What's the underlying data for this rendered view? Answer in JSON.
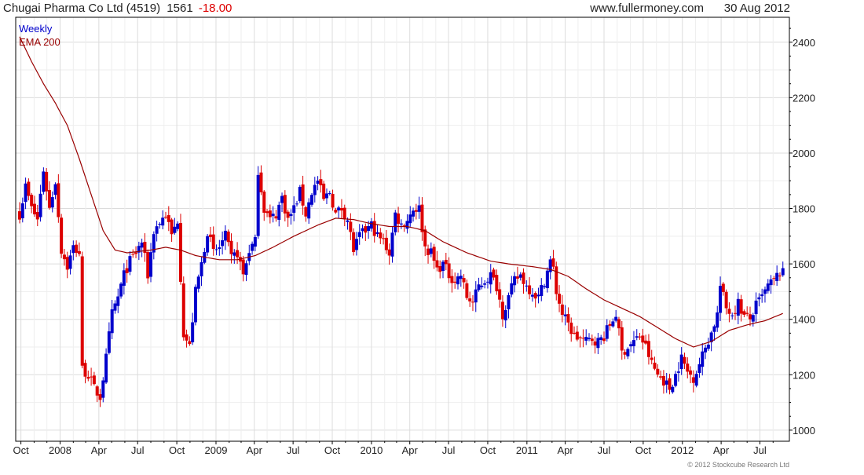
{
  "header": {
    "company": "Chugai Pharma Co Ltd (4519)",
    "price": "1561",
    "change": "-18.00",
    "website": "www.fullermoney.com",
    "date": "30 Aug 2012"
  },
  "legend": {
    "series_label": "Weekly",
    "ema_label": "EMA 200"
  },
  "copyright": "© 2012 Stockcube Research Ltd",
  "colors": {
    "up": "#0000cc",
    "down": "#dd0000",
    "ema": "#990000",
    "grid": "#dcdcdc",
    "frame": "#000000",
    "change_text": "#dd0000"
  },
  "chart_data": {
    "type": "candlestick",
    "period": "weekly",
    "ylim": [
      960,
      2490
    ],
    "yticks": [
      1000,
      1200,
      1400,
      1600,
      1800,
      2000,
      2200,
      2400
    ],
    "grid": true,
    "legend_placement": "top-left",
    "x_tick_labels": [
      "Oct",
      "2008",
      "Apr",
      "Jul",
      "Oct",
      "2009",
      "Apr",
      "Jul",
      "Oct",
      "2010",
      "Apr",
      "Jul",
      "Oct",
      "2011",
      "Apr",
      "Jul",
      "Oct",
      "2012",
      "Apr",
      "Jul"
    ],
    "start_date": "2007-09-28",
    "end_date": "2012-08-30",
    "close_anchors": [
      [
        "2007-09-28",
        1780
      ],
      [
        "2007-10-12",
        1880
      ],
      [
        "2007-10-26",
        1800
      ],
      [
        "2007-11-09",
        1760
      ],
      [
        "2007-11-23",
        1940
      ],
      [
        "2007-12-07",
        1800
      ],
      [
        "2007-12-21",
        1900
      ],
      [
        "2008-01-04",
        1650
      ],
      [
        "2008-01-18",
        1590
      ],
      [
        "2008-02-01",
        1660
      ],
      [
        "2008-02-15",
        1640
      ],
      [
        "2008-02-22",
        1220
      ],
      [
        "2008-03-07",
        1200
      ],
      [
        "2008-03-21",
        1150
      ],
      [
        "2008-04-04",
        1120
      ],
      [
        "2008-04-18",
        1260
      ],
      [
        "2008-05-02",
        1420
      ],
      [
        "2008-05-16",
        1480
      ],
      [
        "2008-05-30",
        1560
      ],
      [
        "2008-06-13",
        1610
      ],
      [
        "2008-06-27",
        1640
      ],
      [
        "2008-07-11",
        1680
      ],
      [
        "2008-07-25",
        1560
      ],
      [
        "2008-08-08",
        1720
      ],
      [
        "2008-08-22",
        1750
      ],
      [
        "2008-09-05",
        1780
      ],
      [
        "2008-09-19",
        1700
      ],
      [
        "2008-10-03",
        1760
      ],
      [
        "2008-10-17",
        1350
      ],
      [
        "2008-10-31",
        1300
      ],
      [
        "2008-11-14",
        1500
      ],
      [
        "2008-11-28",
        1600
      ],
      [
        "2008-12-12",
        1720
      ],
      [
        "2008-12-26",
        1640
      ],
      [
        "2009-01-09",
        1660
      ],
      [
        "2009-01-23",
        1700
      ],
      [
        "2009-02-06",
        1620
      ],
      [
        "2009-02-20",
        1640
      ],
      [
        "2009-03-06",
        1560
      ],
      [
        "2009-03-20",
        1650
      ],
      [
        "2009-04-03",
        1680
      ],
      [
        "2009-04-10",
        1940
      ],
      [
        "2009-04-24",
        1800
      ],
      [
        "2009-05-08",
        1760
      ],
      [
        "2009-05-22",
        1780
      ],
      [
        "2009-06-05",
        1840
      ],
      [
        "2009-06-19",
        1760
      ],
      [
        "2009-07-03",
        1800
      ],
      [
        "2009-07-17",
        1860
      ],
      [
        "2009-07-31",
        1780
      ],
      [
        "2009-08-14",
        1860
      ],
      [
        "2009-08-28",
        1900
      ],
      [
        "2009-09-11",
        1830
      ],
      [
        "2009-09-25",
        1860
      ],
      [
        "2009-10-09",
        1780
      ],
      [
        "2009-10-23",
        1800
      ],
      [
        "2009-11-06",
        1760
      ],
      [
        "2009-11-20",
        1650
      ],
      [
        "2009-12-04",
        1700
      ],
      [
        "2009-12-18",
        1720
      ],
      [
        "2010-01-01",
        1740
      ],
      [
        "2010-01-15",
        1700
      ],
      [
        "2010-01-29",
        1680
      ],
      [
        "2010-02-12",
        1640
      ],
      [
        "2010-02-26",
        1780
      ],
      [
        "2010-03-12",
        1740
      ],
      [
        "2010-03-26",
        1760
      ],
      [
        "2010-04-09",
        1800
      ],
      [
        "2010-04-23",
        1800
      ],
      [
        "2010-05-07",
        1660
      ],
      [
        "2010-05-21",
        1640
      ],
      [
        "2010-06-04",
        1580
      ],
      [
        "2010-06-18",
        1600
      ],
      [
        "2010-07-02",
        1560
      ],
      [
        "2010-07-16",
        1540
      ],
      [
        "2010-07-30",
        1560
      ],
      [
        "2010-08-13",
        1480
      ],
      [
        "2010-08-27",
        1460
      ],
      [
        "2010-09-10",
        1520
      ],
      [
        "2010-09-24",
        1540
      ],
      [
        "2010-10-08",
        1560
      ],
      [
        "2010-10-22",
        1520
      ],
      [
        "2010-11-05",
        1420
      ],
      [
        "2010-11-19",
        1480
      ],
      [
        "2010-12-03",
        1540
      ],
      [
        "2010-12-17",
        1560
      ],
      [
        "2010-12-31",
        1520
      ],
      [
        "2011-01-14",
        1500
      ],
      [
        "2011-01-28",
        1480
      ],
      [
        "2011-02-11",
        1540
      ],
      [
        "2011-02-25",
        1610
      ],
      [
        "2011-03-04",
        1580
      ],
      [
        "2011-03-11",
        1500
      ],
      [
        "2011-03-25",
        1420
      ],
      [
        "2011-04-08",
        1380
      ],
      [
        "2011-04-22",
        1340
      ],
      [
        "2011-05-06",
        1330
      ],
      [
        "2011-05-20",
        1320
      ],
      [
        "2011-06-03",
        1330
      ],
      [
        "2011-06-17",
        1320
      ],
      [
        "2011-07-01",
        1340
      ],
      [
        "2011-07-15",
        1380
      ],
      [
        "2011-07-29",
        1420
      ],
      [
        "2011-08-12",
        1280
      ],
      [
        "2011-08-26",
        1300
      ],
      [
        "2011-09-09",
        1320
      ],
      [
        "2011-09-23",
        1340
      ],
      [
        "2011-10-07",
        1300
      ],
      [
        "2011-10-21",
        1240
      ],
      [
        "2011-11-04",
        1200
      ],
      [
        "2011-11-18",
        1180
      ],
      [
        "2011-12-02",
        1150
      ],
      [
        "2011-12-16",
        1200
      ],
      [
        "2011-12-30",
        1260
      ],
      [
        "2012-01-13",
        1210
      ],
      [
        "2012-01-27",
        1190
      ],
      [
        "2012-02-10",
        1240
      ],
      [
        "2012-02-24",
        1300
      ],
      [
        "2012-03-09",
        1350
      ],
      [
        "2012-03-23",
        1420
      ],
      [
        "2012-03-30",
        1520
      ],
      [
        "2012-04-13",
        1440
      ],
      [
        "2012-04-27",
        1420
      ],
      [
        "2012-05-11",
        1460
      ],
      [
        "2012-05-25",
        1410
      ],
      [
        "2012-06-08",
        1400
      ],
      [
        "2012-06-22",
        1450
      ],
      [
        "2012-07-06",
        1480
      ],
      [
        "2012-07-20",
        1520
      ],
      [
        "2012-08-03",
        1540
      ],
      [
        "2012-08-17",
        1570
      ],
      [
        "2012-08-30",
        1561
      ]
    ],
    "ema_anchors": [
      [
        "2007-09-28",
        2420
      ],
      [
        "2007-10-26",
        2330
      ],
      [
        "2007-11-23",
        2250
      ],
      [
        "2007-12-21",
        2180
      ],
      [
        "2008-01-18",
        2100
      ],
      [
        "2008-02-15",
        1980
      ],
      [
        "2008-03-14",
        1850
      ],
      [
        "2008-04-11",
        1720
      ],
      [
        "2008-05-09",
        1650
      ],
      [
        "2008-06-06",
        1640
      ],
      [
        "2008-07-04",
        1645
      ],
      [
        "2008-08-01",
        1650
      ],
      [
        "2008-09-05",
        1660
      ],
      [
        "2008-10-10",
        1650
      ],
      [
        "2008-11-14",
        1630
      ],
      [
        "2009-01-09",
        1615
      ],
      [
        "2009-02-20",
        1615
      ],
      [
        "2009-04-03",
        1630
      ],
      [
        "2009-05-15",
        1660
      ],
      [
        "2009-07-03",
        1700
      ],
      [
        "2009-08-28",
        1740
      ],
      [
        "2009-10-09",
        1765
      ],
      [
        "2009-11-20",
        1760
      ],
      [
        "2010-01-01",
        1745
      ],
      [
        "2010-02-12",
        1735
      ],
      [
        "2010-03-26",
        1735
      ],
      [
        "2010-05-07",
        1720
      ],
      [
        "2010-06-18",
        1680
      ],
      [
        "2010-08-13",
        1640
      ],
      [
        "2010-10-08",
        1610
      ],
      [
        "2010-11-19",
        1600
      ],
      [
        "2011-01-14",
        1590
      ],
      [
        "2011-02-25",
        1580
      ],
      [
        "2011-04-08",
        1555
      ],
      [
        "2011-05-20",
        1510
      ],
      [
        "2011-07-01",
        1470
      ],
      [
        "2011-08-12",
        1440
      ],
      [
        "2011-09-23",
        1410
      ],
      [
        "2011-11-04",
        1370
      ],
      [
        "2011-12-16",
        1330
      ],
      [
        "2012-01-27",
        1300
      ],
      [
        "2012-03-09",
        1320
      ],
      [
        "2012-04-20",
        1360
      ],
      [
        "2012-06-01",
        1380
      ],
      [
        "2012-07-13",
        1395
      ],
      [
        "2012-08-30",
        1425
      ]
    ]
  }
}
